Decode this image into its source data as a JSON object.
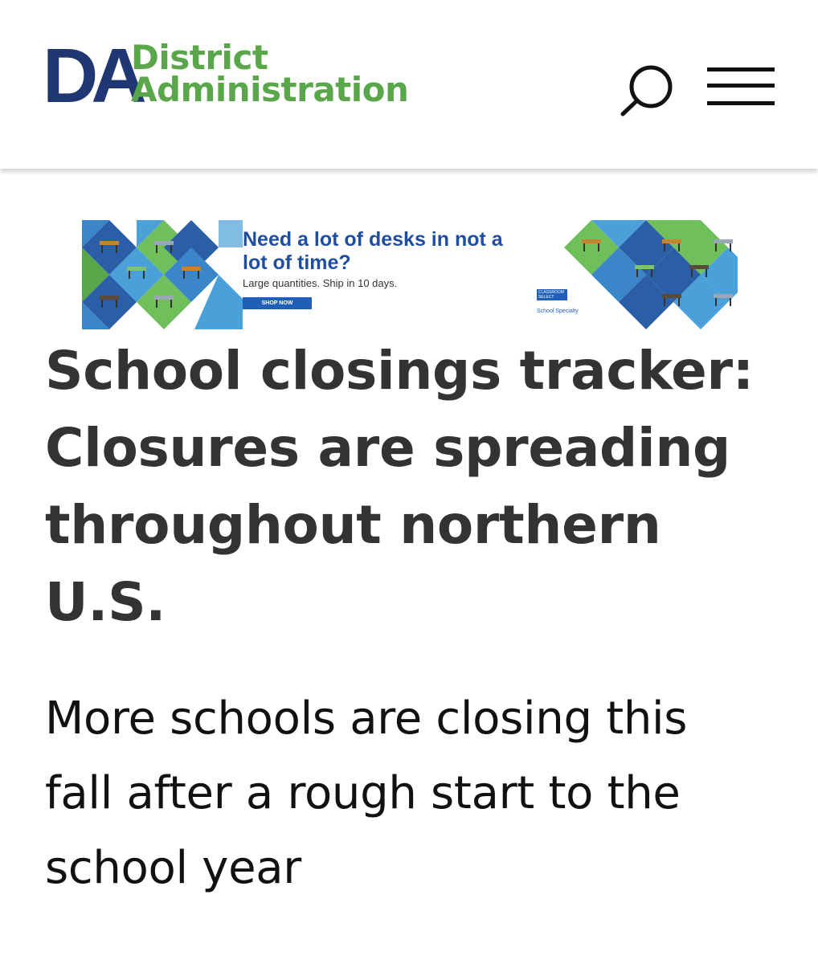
{
  "header": {
    "logo_mark": "DA",
    "logo_line1": "District",
    "logo_line2": "Administration",
    "search_icon": "search-icon",
    "menu_icon": "hamburger-menu-icon"
  },
  "ad": {
    "title": "Need a lot of desks in not a lot of time?",
    "subtitle": "Large quantities. Ship in 10 days.",
    "cta": "SHOP NOW",
    "brand_line1": "CLASSROOM SELECT",
    "brand_line2": "School Specialty"
  },
  "article": {
    "headline": "School closings tracker: Closures are spreading throughout northern U.S.",
    "dek": "More schools are closing this fall after a rough start to the school year"
  },
  "colors": {
    "brand_navy": "#1f3772",
    "brand_green": "#5aa64a",
    "headline": "#333333"
  }
}
